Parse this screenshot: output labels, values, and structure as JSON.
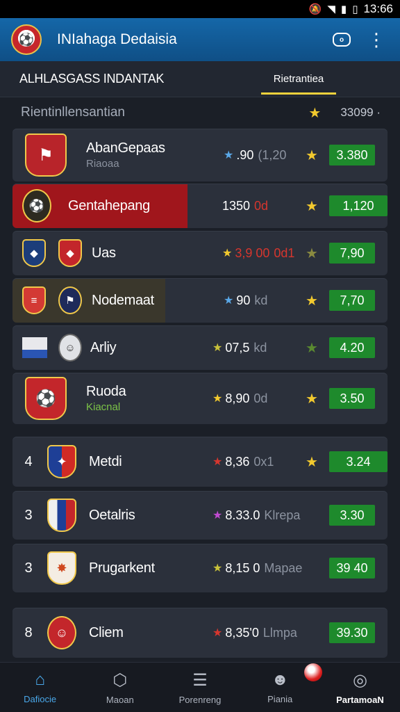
{
  "status_bar": {
    "time": "13:66",
    "icons": [
      "mute-icon",
      "wifi-icon",
      "signal-icon",
      "battery-icon"
    ]
  },
  "app_bar": {
    "title": "INIahaga Dedaisia",
    "logo_icon": "club-crest-icon",
    "actions": [
      "chat-icon",
      "more-vert-icon"
    ]
  },
  "tabs": [
    {
      "label": "ALHLASGASS INDANTAK",
      "active": false
    },
    {
      "label": "Rietrantiea",
      "active": true
    }
  ],
  "section": {
    "label": "Rientinllensantian",
    "value": "33099 ·"
  },
  "rows": [
    {
      "rank": "",
      "name": "AbanGepaas",
      "sub": "Riaoaa",
      "rating": ".90",
      "rating_extra": "(1,20",
      "star_color": "#5aa8e8",
      "odds": "3.380"
    },
    {
      "rank": "",
      "name": "Gentahepang",
      "sub": "",
      "rating": "1350",
      "rating_extra": "0d",
      "star_color": "",
      "odds": "1,120"
    },
    {
      "rank": "",
      "name": "Uas",
      "sub": "",
      "rating": "3,9 00",
      "rating_extra": "0d1",
      "star_color": "#f2c92e",
      "odds": "7,90"
    },
    {
      "rank": "",
      "name": "Nodemaat",
      "sub": "",
      "rating": "90",
      "rating_extra": "kd",
      "star_color": "#5aa8e8",
      "odds": "7,70"
    },
    {
      "rank": "",
      "name": "Arliy",
      "sub": "",
      "rating": "07,5",
      "rating_extra": "kd",
      "star_color": "#c9c23a",
      "odds": "4.20"
    },
    {
      "rank": "",
      "name": "Ruoda",
      "sub": "Kiacnal",
      "rating": "8,90",
      "rating_extra": "0d",
      "star_color": "#f2c92e",
      "odds": "3.50"
    },
    {
      "rank": "4",
      "name": "Metdi",
      "sub": "",
      "rating": "8,36",
      "rating_extra": "0x1",
      "star_color": "#d6362e",
      "odds": "3.24"
    },
    {
      "rank": "3",
      "name": "Oetalris",
      "sub": "",
      "rating": "8.33.0",
      "rating_extra": "Klrepa",
      "star_color": "#c04ad0",
      "odds": "3.30"
    },
    {
      "rank": "3",
      "name": "Prugarkent",
      "sub": "",
      "rating": "8,15 0",
      "rating_extra": "Mapae",
      "star_color": "#c9c23a",
      "odds": "39 40"
    },
    {
      "rank": "8",
      "name": "Cliem",
      "sub": "",
      "rating": "8,35'0",
      "rating_extra": "Llmpa",
      "star_color": "#d6362e",
      "odds": "39.30"
    }
  ],
  "nav": [
    {
      "label": "Dafiocie",
      "icon": "home-icon"
    },
    {
      "label": "Maoan",
      "icon": "shield-icon"
    },
    {
      "label": "Porenreng",
      "icon": "list-icon"
    },
    {
      "label": "Piania",
      "icon": "mask-icon"
    },
    {
      "label": "PartamoaN",
      "icon": "ball-icon"
    }
  ]
}
